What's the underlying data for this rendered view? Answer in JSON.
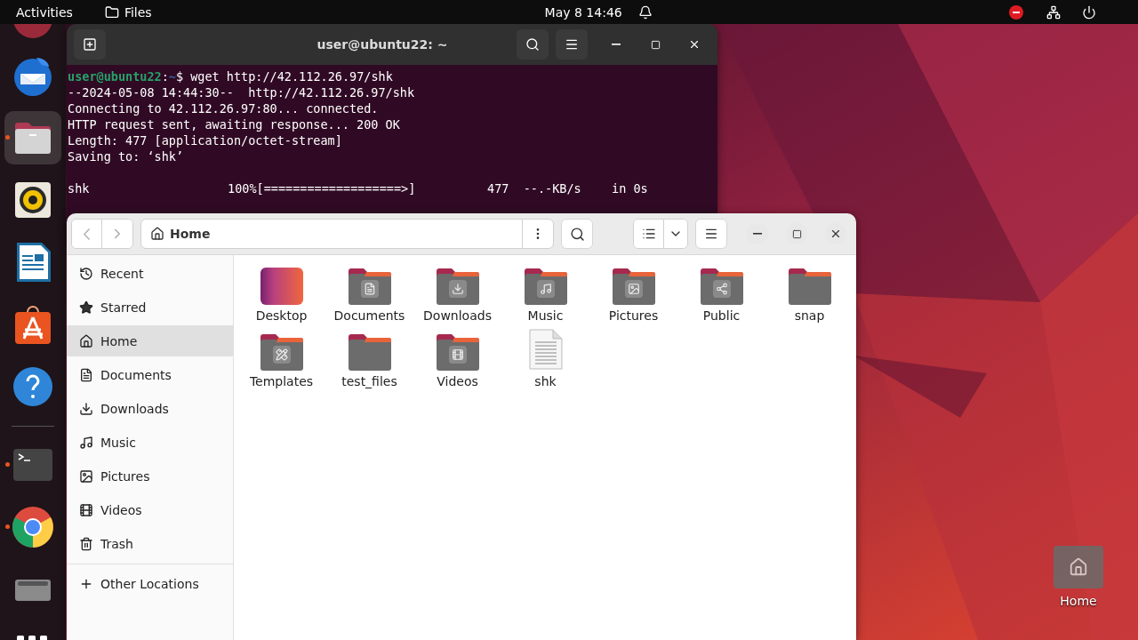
{
  "top_bar": {
    "activities": "Activities",
    "app": "Files",
    "clock": "May 8  14:46"
  },
  "dock": [
    {
      "kind": "firefox",
      "selected": false
    },
    {
      "kind": "thunderbird",
      "running": false,
      "selected": false
    },
    {
      "kind": "files",
      "running": true,
      "selected": true
    },
    {
      "kind": "rhythmbox",
      "running": false,
      "selected": false
    },
    {
      "kind": "writer",
      "running": false,
      "selected": false
    },
    {
      "kind": "appcenter",
      "running": false,
      "selected": false
    },
    {
      "kind": "help",
      "running": false,
      "selected": false
    },
    {
      "kind": "separator",
      "selected": false
    },
    {
      "kind": "terminal",
      "running": true,
      "selected": false
    },
    {
      "kind": "chrome",
      "running": true,
      "selected": false
    },
    {
      "kind": "drive",
      "running": false,
      "selected": false
    },
    {
      "kind": "apps",
      "selected": false
    }
  ],
  "terminal": {
    "title": "user@ubuntu22: ~",
    "prompt": {
      "user": "user@ubuntu22",
      "separator": ":",
      "path": "~",
      "symbol": "$",
      "command": "wget http://42.112.26.97/shk"
    },
    "output": [
      "--2024-05-08 14:44:30--  http://42.112.26.97/shk",
      "Connecting to 42.112.26.97:80... connected.",
      "HTTP request sent, awaiting response... 200 OK",
      "Length: 477 [application/octet-stream]",
      "Saving to: ‘shk’"
    ],
    "progress": {
      "name": "shk",
      "percent": "100%",
      "bar": "[===================>]",
      "size": "477",
      "speed": "--.-KB/s",
      "time": "in 0s"
    }
  },
  "files": {
    "location": "Home",
    "sidebar": [
      {
        "label": "Recent",
        "kind": "recent",
        "selected": false
      },
      {
        "label": "Starred",
        "kind": "starred",
        "selected": false
      },
      {
        "label": "Home",
        "kind": "home",
        "selected": true
      },
      {
        "label": "Documents",
        "kind": "documents",
        "selected": false
      },
      {
        "label": "Downloads",
        "kind": "downloads",
        "selected": false
      },
      {
        "label": "Music",
        "kind": "music",
        "selected": false
      },
      {
        "label": "Pictures",
        "kind": "pictures",
        "selected": false
      },
      {
        "label": "Videos",
        "kind": "videos",
        "selected": false
      },
      {
        "label": "Trash",
        "kind": "trash",
        "selected": false
      }
    ],
    "other_locations": "Other Locations",
    "items": [
      {
        "name": "Desktop",
        "kind": "desktop"
      },
      {
        "name": "Documents",
        "kind": "documents"
      },
      {
        "name": "Downloads",
        "kind": "downloads"
      },
      {
        "name": "Music",
        "kind": "music"
      },
      {
        "name": "Pictures",
        "kind": "pictures"
      },
      {
        "name": "Public",
        "kind": "public"
      },
      {
        "name": "snap",
        "kind": "folder"
      },
      {
        "name": "Templates",
        "kind": "templates"
      },
      {
        "name": "test_files",
        "kind": "folder"
      },
      {
        "name": "Videos",
        "kind": "videos"
      },
      {
        "name": "shk",
        "kind": "file"
      }
    ]
  },
  "desktop_icons": [
    {
      "name": "Home",
      "kind": "home"
    }
  ]
}
